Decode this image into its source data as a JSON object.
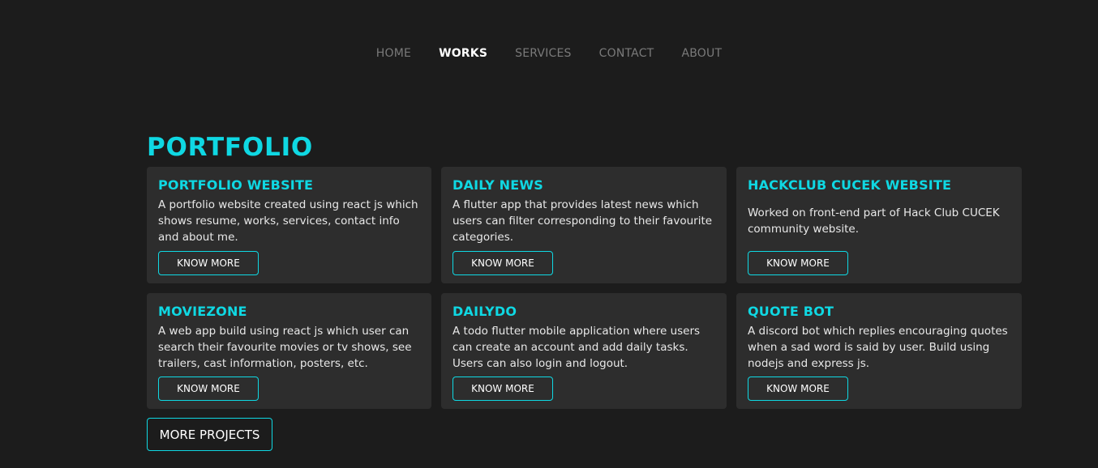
{
  "nav": {
    "items": [
      {
        "label": "HOME",
        "active": false
      },
      {
        "label": "WORKS",
        "active": true
      },
      {
        "label": "SERVICES",
        "active": false
      },
      {
        "label": "CONTACT",
        "active": false
      },
      {
        "label": "ABOUT",
        "active": false
      }
    ]
  },
  "portfolio": {
    "title": "PORTFOLIO",
    "projects": [
      {
        "title": "PORTFOLIO WEBSITE",
        "description": "A portfolio website created using react js which shows resume, works, services, contact info and about me.",
        "button": "KNOW MORE"
      },
      {
        "title": "DAILY NEWS",
        "description": "A flutter app that provides latest news which users can filter corresponding to their favourite categories.",
        "button": "KNOW MORE"
      },
      {
        "title": "HACKCLUB CUCEK WEBSITE",
        "description": "Worked on front-end part of Hack Club CUCEK community website.",
        "button": "KNOW MORE"
      },
      {
        "title": "MOVIEZONE",
        "description": "A web app build using react js which user can search their favourite movies or tv shows, see trailers, cast information, posters, etc.",
        "button": "KNOW MORE"
      },
      {
        "title": "DAILYDO",
        "description": "A todo flutter mobile application where users can create an account and add daily tasks. Users can also login and logout.",
        "button": "KNOW MORE"
      },
      {
        "title": "QUOTE BOT",
        "description": "A discord bot which replies encouraging quotes when a sad word is said by user. Build using nodejs and express js.",
        "button": "KNOW MORE"
      }
    ],
    "more_button": "MORE PROJECTS"
  },
  "colors": {
    "background": "#1c1c1c",
    "card": "#2d2d2d",
    "accent": "#0fd8e3",
    "nav_inactive": "#7a7a7a"
  }
}
